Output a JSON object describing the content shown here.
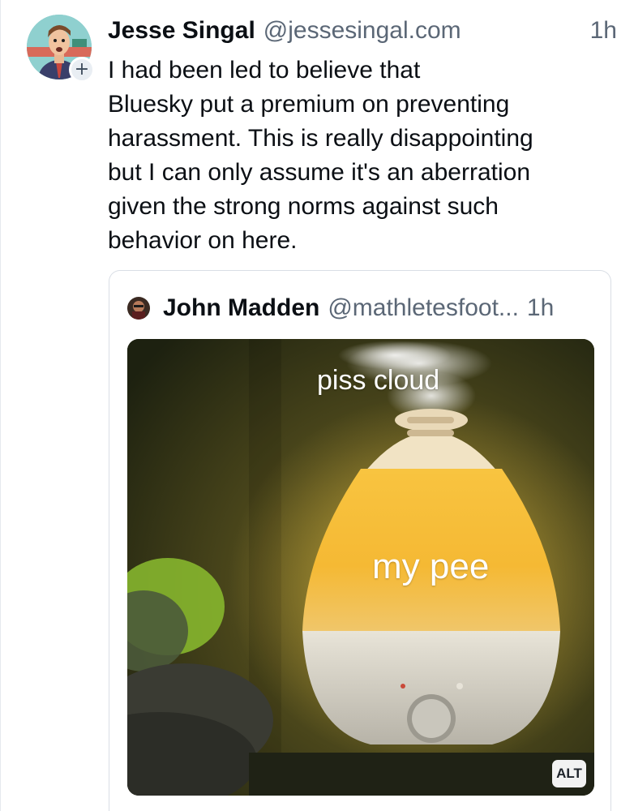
{
  "post": {
    "author": {
      "display_name": "Jesse Singal",
      "handle": "@jessesingal.com",
      "avatar_icon": "cartoon-avatar",
      "follow_badge": "+"
    },
    "time": "1h",
    "text_lines": [
      "I had been led to believe that",
      "Bluesky put a premium on preventing",
      "harassment. This is really disappointing",
      "but I can only assume it's an aberration",
      "given the strong norms against such",
      "behavior on here."
    ]
  },
  "quote": {
    "author": {
      "display_name": "John Madden",
      "handle": "@mathletesfoot...",
      "avatar_icon": "profile-photo"
    },
    "time": "1h",
    "image": {
      "caption_top": "piss cloud",
      "caption_center": "my pee",
      "alt_badge": "ALT"
    }
  },
  "colors": {
    "text_primary": "#0b0f14",
    "text_secondary": "#5b6776",
    "border": "#d9dee5",
    "lamp_glow": "#f5b934"
  }
}
